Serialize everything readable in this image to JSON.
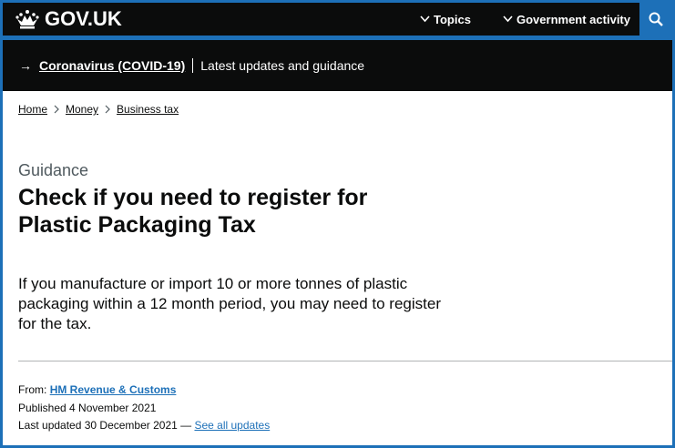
{
  "header": {
    "logo_text": "GOV.UK",
    "nav": [
      {
        "label": "Topics"
      },
      {
        "label": "Government activity"
      }
    ],
    "search_icon": "search-icon",
    "brand_color": "#1d70b8"
  },
  "banner": {
    "arrow": "→",
    "link": "Coronavirus (COVID-19)",
    "text": "Latest updates and guidance"
  },
  "breadcrumb": [
    "Home",
    "Money",
    "Business tax"
  ],
  "content": {
    "caption": "Guidance",
    "title": "Check if you need to register for Plastic Packaging Tax",
    "lead": "If you manufacture or import 10 or more tonnes of plastic packaging within a 12 month period, you may need to register for the tax."
  },
  "meta": {
    "from_label": "From:",
    "from_org": "HM Revenue & Customs",
    "published": "Published 4 November 2021",
    "updated": "Last updated 30 December 2021 —",
    "see_all": "See all updates"
  }
}
